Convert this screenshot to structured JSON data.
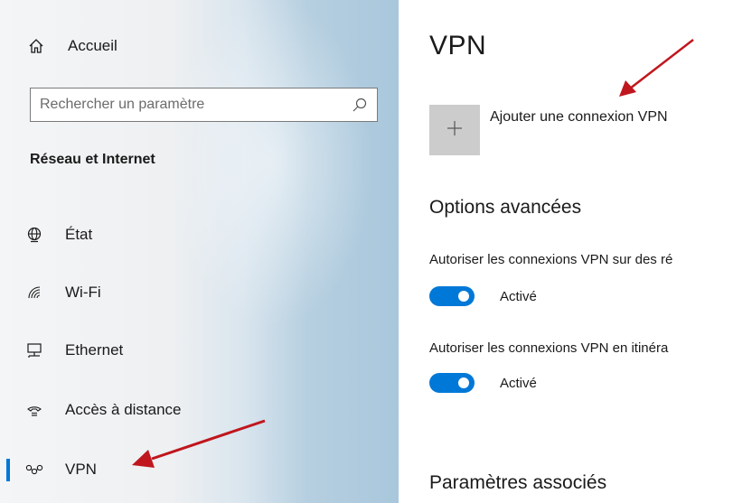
{
  "sidebar": {
    "home_label": "Accueil",
    "search": {
      "placeholder": "Rechercher un paramètre",
      "value": ""
    },
    "section_title": "Réseau et Internet",
    "items": [
      {
        "label": "État",
        "icon": "globe-icon"
      },
      {
        "label": "Wi-Fi",
        "icon": "wifi-icon"
      },
      {
        "label": "Ethernet",
        "icon": "ethernet-icon"
      },
      {
        "label": "Accès à distance",
        "icon": "dialup-icon"
      },
      {
        "label": "VPN",
        "icon": "vpn-icon",
        "selected": true
      }
    ]
  },
  "main": {
    "title": "VPN",
    "add_vpn_label": "Ajouter une connexion VPN",
    "advanced_title": "Options avancées",
    "option1_desc": "Autoriser les connexions VPN sur des ré",
    "option1_state": "Activé",
    "option2_desc": "Autoriser les connexions VPN en itinéra",
    "option2_state": "Activé",
    "related_title": "Paramètres associés"
  },
  "colors": {
    "accent": "#0078d7",
    "annotation_arrow": "#c0161d"
  }
}
